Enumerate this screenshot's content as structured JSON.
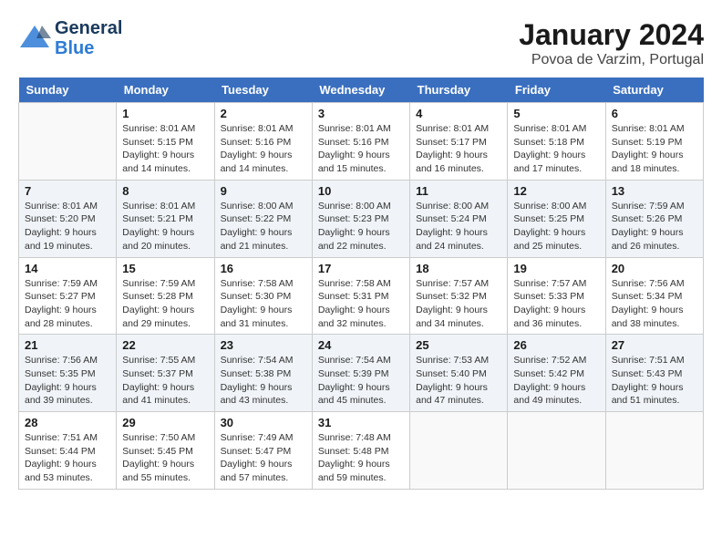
{
  "header": {
    "logo_general": "General",
    "logo_blue": "Blue",
    "title": "January 2024",
    "subtitle": "Povoa de Varzim, Portugal"
  },
  "calendar": {
    "days_of_week": [
      "Sunday",
      "Monday",
      "Tuesday",
      "Wednesday",
      "Thursday",
      "Friday",
      "Saturday"
    ],
    "weeks": [
      [
        {
          "day": "",
          "info": ""
        },
        {
          "day": "1",
          "info": "Sunrise: 8:01 AM\nSunset: 5:15 PM\nDaylight: 9 hours\nand 14 minutes."
        },
        {
          "day": "2",
          "info": "Sunrise: 8:01 AM\nSunset: 5:16 PM\nDaylight: 9 hours\nand 14 minutes."
        },
        {
          "day": "3",
          "info": "Sunrise: 8:01 AM\nSunset: 5:16 PM\nDaylight: 9 hours\nand 15 minutes."
        },
        {
          "day": "4",
          "info": "Sunrise: 8:01 AM\nSunset: 5:17 PM\nDaylight: 9 hours\nand 16 minutes."
        },
        {
          "day": "5",
          "info": "Sunrise: 8:01 AM\nSunset: 5:18 PM\nDaylight: 9 hours\nand 17 minutes."
        },
        {
          "day": "6",
          "info": "Sunrise: 8:01 AM\nSunset: 5:19 PM\nDaylight: 9 hours\nand 18 minutes."
        }
      ],
      [
        {
          "day": "7",
          "info": "Sunrise: 8:01 AM\nSunset: 5:20 PM\nDaylight: 9 hours\nand 19 minutes."
        },
        {
          "day": "8",
          "info": "Sunrise: 8:01 AM\nSunset: 5:21 PM\nDaylight: 9 hours\nand 20 minutes."
        },
        {
          "day": "9",
          "info": "Sunrise: 8:00 AM\nSunset: 5:22 PM\nDaylight: 9 hours\nand 21 minutes."
        },
        {
          "day": "10",
          "info": "Sunrise: 8:00 AM\nSunset: 5:23 PM\nDaylight: 9 hours\nand 22 minutes."
        },
        {
          "day": "11",
          "info": "Sunrise: 8:00 AM\nSunset: 5:24 PM\nDaylight: 9 hours\nand 24 minutes."
        },
        {
          "day": "12",
          "info": "Sunrise: 8:00 AM\nSunset: 5:25 PM\nDaylight: 9 hours\nand 25 minutes."
        },
        {
          "day": "13",
          "info": "Sunrise: 7:59 AM\nSunset: 5:26 PM\nDaylight: 9 hours\nand 26 minutes."
        }
      ],
      [
        {
          "day": "14",
          "info": "Sunrise: 7:59 AM\nSunset: 5:27 PM\nDaylight: 9 hours\nand 28 minutes."
        },
        {
          "day": "15",
          "info": "Sunrise: 7:59 AM\nSunset: 5:28 PM\nDaylight: 9 hours\nand 29 minutes."
        },
        {
          "day": "16",
          "info": "Sunrise: 7:58 AM\nSunset: 5:30 PM\nDaylight: 9 hours\nand 31 minutes."
        },
        {
          "day": "17",
          "info": "Sunrise: 7:58 AM\nSunset: 5:31 PM\nDaylight: 9 hours\nand 32 minutes."
        },
        {
          "day": "18",
          "info": "Sunrise: 7:57 AM\nSunset: 5:32 PM\nDaylight: 9 hours\nand 34 minutes."
        },
        {
          "day": "19",
          "info": "Sunrise: 7:57 AM\nSunset: 5:33 PM\nDaylight: 9 hours\nand 36 minutes."
        },
        {
          "day": "20",
          "info": "Sunrise: 7:56 AM\nSunset: 5:34 PM\nDaylight: 9 hours\nand 38 minutes."
        }
      ],
      [
        {
          "day": "21",
          "info": "Sunrise: 7:56 AM\nSunset: 5:35 PM\nDaylight: 9 hours\nand 39 minutes."
        },
        {
          "day": "22",
          "info": "Sunrise: 7:55 AM\nSunset: 5:37 PM\nDaylight: 9 hours\nand 41 minutes."
        },
        {
          "day": "23",
          "info": "Sunrise: 7:54 AM\nSunset: 5:38 PM\nDaylight: 9 hours\nand 43 minutes."
        },
        {
          "day": "24",
          "info": "Sunrise: 7:54 AM\nSunset: 5:39 PM\nDaylight: 9 hours\nand 45 minutes."
        },
        {
          "day": "25",
          "info": "Sunrise: 7:53 AM\nSunset: 5:40 PM\nDaylight: 9 hours\nand 47 minutes."
        },
        {
          "day": "26",
          "info": "Sunrise: 7:52 AM\nSunset: 5:42 PM\nDaylight: 9 hours\nand 49 minutes."
        },
        {
          "day": "27",
          "info": "Sunrise: 7:51 AM\nSunset: 5:43 PM\nDaylight: 9 hours\nand 51 minutes."
        }
      ],
      [
        {
          "day": "28",
          "info": "Sunrise: 7:51 AM\nSunset: 5:44 PM\nDaylight: 9 hours\nand 53 minutes."
        },
        {
          "day": "29",
          "info": "Sunrise: 7:50 AM\nSunset: 5:45 PM\nDaylight: 9 hours\nand 55 minutes."
        },
        {
          "day": "30",
          "info": "Sunrise: 7:49 AM\nSunset: 5:47 PM\nDaylight: 9 hours\nand 57 minutes."
        },
        {
          "day": "31",
          "info": "Sunrise: 7:48 AM\nSunset: 5:48 PM\nDaylight: 9 hours\nand 59 minutes."
        },
        {
          "day": "",
          "info": ""
        },
        {
          "day": "",
          "info": ""
        },
        {
          "day": "",
          "info": ""
        }
      ]
    ]
  }
}
